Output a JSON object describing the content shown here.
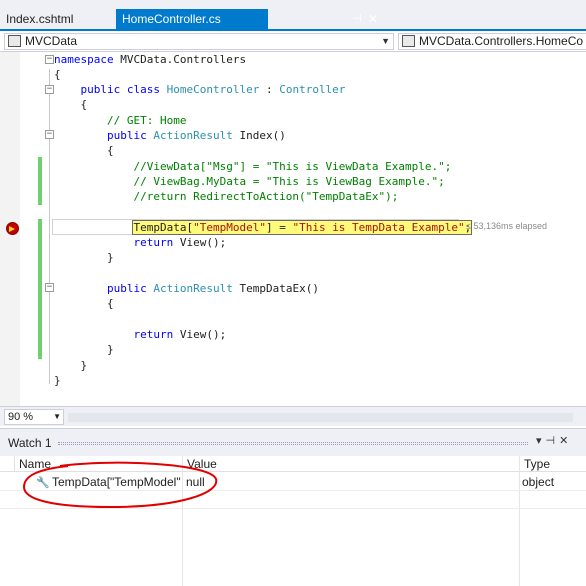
{
  "tabs": [
    {
      "label": "Index.cshtml"
    },
    {
      "label": "HomeController.cs",
      "active": true,
      "pin_icon": "pin-icon",
      "close_icon": "close-icon"
    }
  ],
  "nav": {
    "left_label": "MVCData",
    "right_label": "MVCData.Controllers.HomeCo"
  },
  "code": [
    "namespace MVCData.Controllers",
    "{",
    "    public class HomeController : Controller",
    "    {",
    "        // GET: Home",
    "        public ActionResult Index()",
    "        {",
    "            //ViewData[\"Msg\"] = \"This is ViewData Example.\";",
    "            // ViewBag.MyData = \"This is ViewBag Example.\";",
    "            //return RedirectToAction(\"TempDataEx\");",
    "",
    "            TempData[\"TempModel\"] = \"This is TempData Example\";",
    "            return View();",
    "        }",
    "",
    "        public ActionResult TempDataEx()",
    "        {",
    "",
    "            return View();",
    "        }",
    "    }",
    "}"
  ],
  "elapsed": "≤ 53,136ms elapsed",
  "zoom": "90 %",
  "watch": {
    "title": "Watch 1",
    "columns": [
      "Name",
      "Value",
      "Type"
    ],
    "rows": [
      {
        "name": "TempData[\"TempModel\"",
        "value": "null",
        "type": "object"
      }
    ]
  },
  "colors": {
    "accent": "#007acc",
    "keyword": "#0000ff",
    "type": "#2b91af",
    "string": "#a31515",
    "comment": "#008000",
    "exec_highlight": "#fffa7a",
    "annotation": "#e00000"
  }
}
